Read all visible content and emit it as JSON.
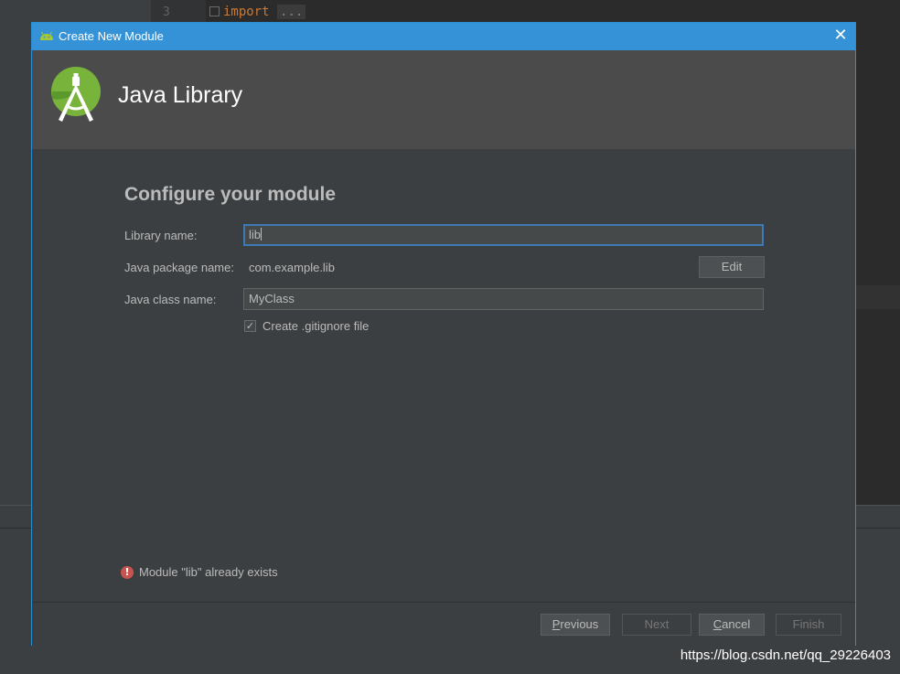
{
  "ide": {
    "line_number": "3",
    "code_keyword": "import",
    "code_fold": "..."
  },
  "dialog": {
    "window_title": "Create New Module",
    "header_title": "Java Library",
    "section_title": "Configure your module",
    "fields": {
      "library_name_label": "Library name:",
      "library_name_value": "lib",
      "package_label": "Java package name:",
      "package_value": "com.example.lib",
      "edit_button": "Edit",
      "class_label": "Java class name:",
      "class_value": "MyClass"
    },
    "gitignore": {
      "label": "Create .gitignore file",
      "checked": true
    },
    "error_message": "Module \"lib\" already exists",
    "buttons": {
      "previous": "Previous",
      "next": "Next",
      "cancel": "Cancel",
      "finish": "Finish"
    }
  },
  "watermark": "https://blog.csdn.net/qq_29226403",
  "colors": {
    "titlebar": "#3592d6",
    "header": "#4b4b4b",
    "dialog_bg": "#3c3f41",
    "android_green": "#a4c639",
    "error_red": "#c75450"
  }
}
